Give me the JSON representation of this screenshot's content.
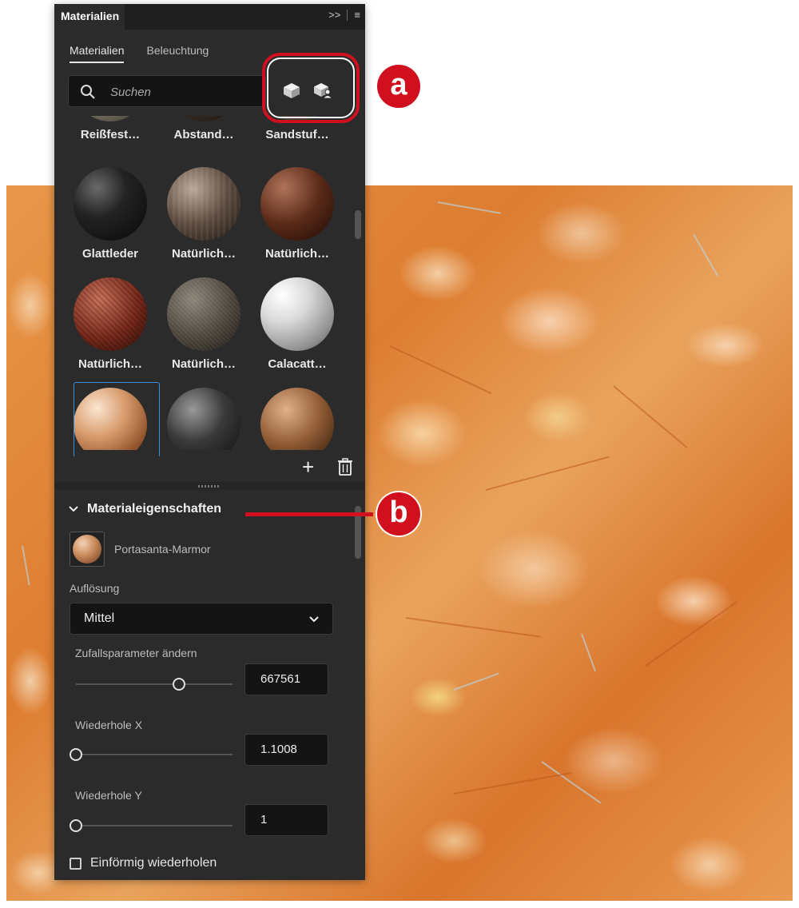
{
  "panel": {
    "title": "Materialien",
    "tabs": [
      "Materialien",
      "Beleuchtung"
    ],
    "search_placeholder": "Suchen",
    "materials": [
      {
        "label": "Reißfest…",
        "sphere": "mat-1"
      },
      {
        "label": "Abstand…",
        "sphere": "mat-2"
      },
      {
        "label": "Sandstuf…",
        "sphere": "mat-3"
      },
      {
        "label": "Glattleder",
        "sphere": "mat-4"
      },
      {
        "label": "Natürlich…",
        "sphere": "mat-5"
      },
      {
        "label": "Natürlich…",
        "sphere": "mat-6"
      },
      {
        "label": "Natürlich…",
        "sphere": "mat-7"
      },
      {
        "label": "Natürlich…",
        "sphere": "mat-8"
      },
      {
        "label": "Calacatt…",
        "sphere": "mat-9"
      },
      {
        "label": "",
        "sphere": "mat-10",
        "selected": true
      },
      {
        "label": "",
        "sphere": "mat-11"
      },
      {
        "label": "",
        "sphere": "mat-12"
      }
    ],
    "add_label": "+"
  },
  "properties": {
    "section_title": "Materialeigenschaften",
    "material_name": "Portasanta-Marmor",
    "resolution_label": "Auflösung",
    "resolution_value": "Mittel",
    "random_label": "Zufallsparameter ändern",
    "random_value": "667561",
    "random_slider_level": 0.66,
    "repeat_x_label": "Wiederhole X",
    "repeat_x_value": "1.1008",
    "repeat_x_level": 0.0,
    "repeat_y_label": "Wiederhole Y",
    "repeat_y_value": "1",
    "repeat_y_level": 0.0,
    "uniform_label": "Einförmig wiederholen",
    "uniform_checked": false
  },
  "annotations": {
    "a": "a",
    "b": "b",
    "color": "#d1101f"
  },
  "colors": {
    "panel_bg": "#2b2b2b",
    "selection": "#3a8fe0"
  }
}
